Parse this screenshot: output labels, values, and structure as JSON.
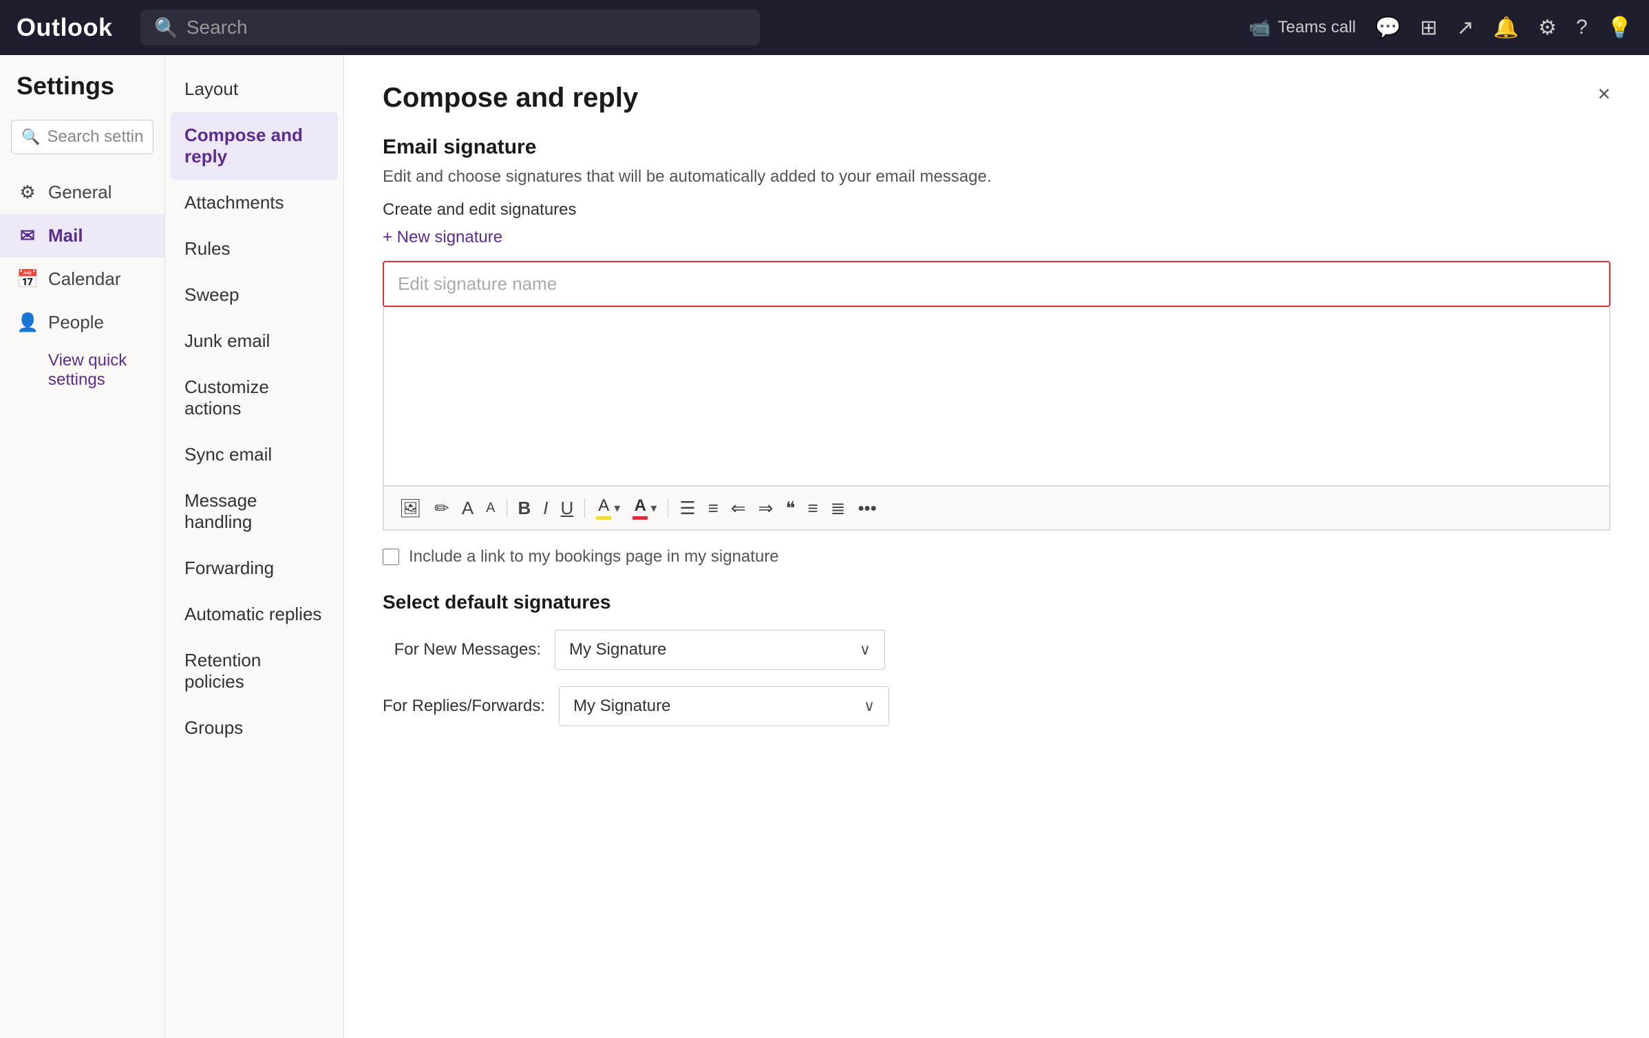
{
  "topbar": {
    "logo": "Outlook",
    "search_placeholder": "Search",
    "teams_call_label": "Teams call",
    "icons": {
      "video": "📹",
      "chat": "💬",
      "grid": "⊞",
      "share": "↗",
      "bell": "🔔",
      "settings": "⚙",
      "help": "?",
      "lightbulb": "💡"
    }
  },
  "sidebar": {
    "title": "Settings",
    "search_placeholder": "Search settings",
    "nav_items": [
      {
        "id": "general",
        "icon": "⚙",
        "label": "General"
      },
      {
        "id": "mail",
        "icon": "✉",
        "label": "Mail",
        "active": true
      },
      {
        "id": "calendar",
        "icon": "📅",
        "label": "Calendar"
      },
      {
        "id": "people",
        "icon": "👤",
        "label": "People"
      }
    ],
    "quick_settings_link": "View quick settings"
  },
  "sub_sidebar": {
    "items": [
      {
        "id": "layout",
        "label": "Layout"
      },
      {
        "id": "compose",
        "label": "Compose and reply",
        "active": true
      },
      {
        "id": "attachments",
        "label": "Attachments"
      },
      {
        "id": "rules",
        "label": "Rules"
      },
      {
        "id": "sweep",
        "label": "Sweep"
      },
      {
        "id": "junk",
        "label": "Junk email"
      },
      {
        "id": "customize",
        "label": "Customize actions"
      },
      {
        "id": "sync",
        "label": "Sync email"
      },
      {
        "id": "handling",
        "label": "Message handling"
      },
      {
        "id": "forwarding",
        "label": "Forwarding"
      },
      {
        "id": "automatic",
        "label": "Automatic replies"
      },
      {
        "id": "retention",
        "label": "Retention policies"
      },
      {
        "id": "groups",
        "label": "Groups"
      }
    ]
  },
  "content": {
    "title": "Compose and reply",
    "close_label": "×",
    "email_signature": {
      "section_title": "Email signature",
      "description": "Edit and choose signatures that will be automatically added to your email message.",
      "create_label": "Create and edit signatures",
      "new_sig_label": "+ New signature",
      "sig_name_placeholder": "Edit signature name",
      "bookings_checkbox_label": "Include a link to my bookings page in my signature"
    },
    "select_defaults": {
      "title": "Select default signatures",
      "new_messages_label": "For New Messages:",
      "new_messages_value": "My Signature",
      "replies_label": "For Replies/Forwards:",
      "replies_value": "My Signature"
    },
    "toolbar": {
      "image": "🖼",
      "pen": "✏",
      "font_size": "A",
      "font_size2": "A",
      "bold": "B",
      "italic": "I",
      "underline": "U",
      "highlight": "A",
      "font_color": "A",
      "indent_dec": "⇐",
      "indent_inc": "⇒",
      "quote": "❝",
      "align_left": "≡",
      "align_right": "≣",
      "more": "..."
    }
  }
}
